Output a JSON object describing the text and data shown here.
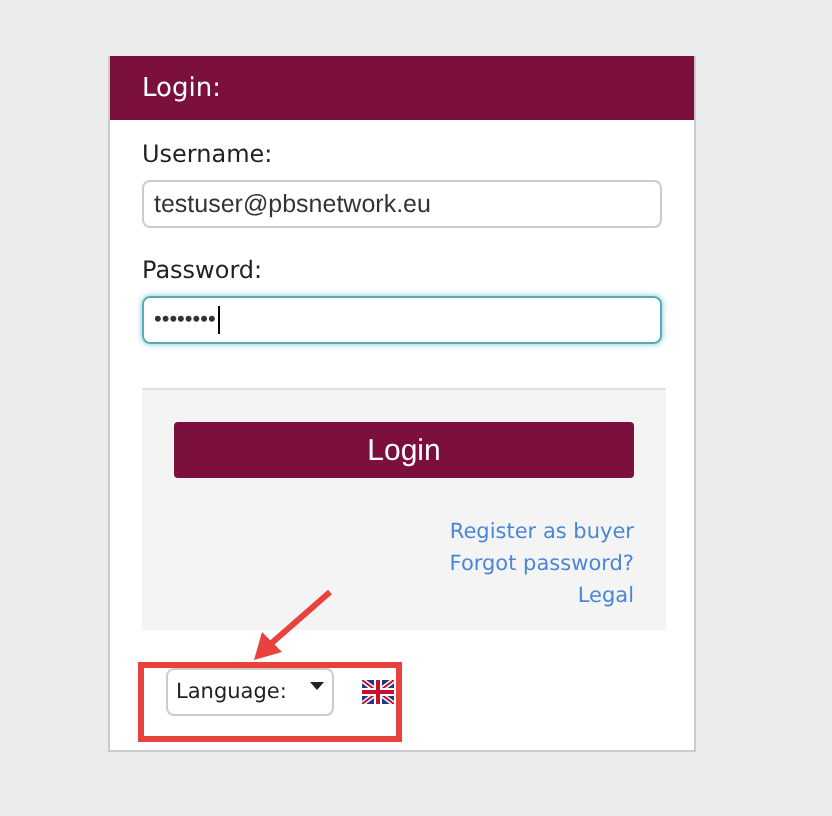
{
  "panel": {
    "title": "Login:"
  },
  "fields": [
    {
      "label": "Username:",
      "value": "testuser@pbsnetwork.eu",
      "kind": "text",
      "focused": false
    },
    {
      "label": "Password:",
      "value": "••••••••",
      "kind": "password",
      "focused": true
    }
  ],
  "login_button": "Login",
  "links": [
    "Register as buyer",
    "Forgot password?",
    "Legal"
  ],
  "language": {
    "label": "Language:"
  },
  "annotation": {
    "kind": "highlight"
  }
}
